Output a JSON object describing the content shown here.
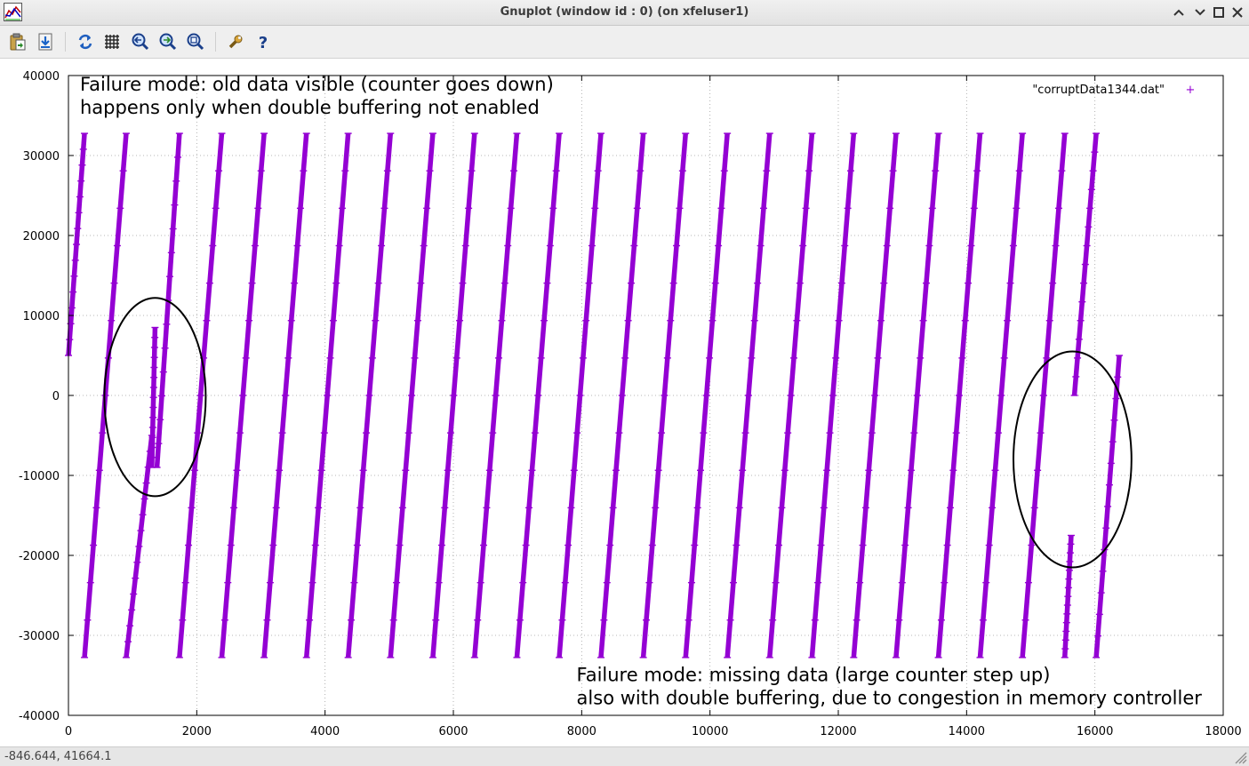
{
  "window": {
    "title": "Gnuplot (window id : 0) (on xfeluser1)"
  },
  "toolbar": {
    "buttons": [
      {
        "name": "copy-clipboard",
        "icon": "clipboard-icon"
      },
      {
        "name": "export",
        "icon": "export-down-icon"
      },
      {
        "name": "replot",
        "icon": "refresh-icon"
      },
      {
        "name": "grid",
        "icon": "grid-icon"
      },
      {
        "name": "previous-zoom",
        "icon": "zoom-prev-icon"
      },
      {
        "name": "next-zoom",
        "icon": "zoom-next-icon"
      },
      {
        "name": "autoscale",
        "icon": "zoom-autoscale-icon"
      },
      {
        "name": "settings",
        "icon": "wrench-icon"
      },
      {
        "name": "help",
        "icon": "help-icon"
      }
    ]
  },
  "status": {
    "coords": "-846.644,  41664.1"
  },
  "colors": {
    "series": "#9400d3",
    "grid": "#a0a0a0",
    "axis": "#000000",
    "annotation": "#000000"
  },
  "chart_data": {
    "type": "line",
    "title": "",
    "xlabel": "",
    "ylabel": "",
    "xlim": [
      0,
      18000
    ],
    "ylim": [
      -40000,
      40000
    ],
    "grid": true,
    "legend_position": "top-right",
    "xticks": [
      0,
      2000,
      4000,
      6000,
      8000,
      10000,
      12000,
      14000,
      16000,
      18000
    ],
    "yticks": [
      -40000,
      -30000,
      -20000,
      -10000,
      0,
      10000,
      20000,
      30000,
      40000
    ],
    "series": [
      {
        "name": "\"corruptData1344.dat\"",
        "marker": "+",
        "segments": [
          [
            [
              0,
              5000
            ],
            [
              250,
              32767
            ]
          ],
          [
            [
              250,
              -32768
            ],
            [
              900,
              32767
            ]
          ],
          [
            [
              900,
              -32768
            ],
            [
              1300,
              -5000
            ]
          ],
          [
            [
              1300,
              -9000
            ],
            [
              1350,
              8500
            ]
          ],
          [
            [
              1380,
              -9000
            ],
            [
              1730,
              32767
            ]
          ],
          [
            [
              1730,
              -32768
            ],
            [
              2390,
              32767
            ]
          ],
          [
            [
              2390,
              -32768
            ],
            [
              3050,
              32767
            ]
          ],
          [
            [
              3050,
              -32768
            ],
            [
              3710,
              32767
            ]
          ],
          [
            [
              3710,
              -32768
            ],
            [
              4360,
              32767
            ]
          ],
          [
            [
              4360,
              -32768
            ],
            [
              5020,
              32767
            ]
          ],
          [
            [
              5020,
              -32768
            ],
            [
              5680,
              32767
            ]
          ],
          [
            [
              5680,
              -32768
            ],
            [
              6330,
              32767
            ]
          ],
          [
            [
              6330,
              -32768
            ],
            [
              6990,
              32767
            ]
          ],
          [
            [
              6990,
              -32768
            ],
            [
              7650,
              32767
            ]
          ],
          [
            [
              7650,
              -32768
            ],
            [
              8300,
              32767
            ]
          ],
          [
            [
              8300,
              -32768
            ],
            [
              8960,
              32767
            ]
          ],
          [
            [
              8960,
              -32768
            ],
            [
              9620,
              32767
            ]
          ],
          [
            [
              9620,
              -32768
            ],
            [
              10270,
              32767
            ]
          ],
          [
            [
              10270,
              -32768
            ],
            [
              10930,
              32767
            ]
          ],
          [
            [
              10930,
              -32768
            ],
            [
              11590,
              32767
            ]
          ],
          [
            [
              11590,
              -32768
            ],
            [
              12240,
              32767
            ]
          ],
          [
            [
              12240,
              -32768
            ],
            [
              12900,
              32767
            ]
          ],
          [
            [
              12900,
              -32768
            ],
            [
              13560,
              32767
            ]
          ],
          [
            [
              13560,
              -32768
            ],
            [
              14210,
              32767
            ]
          ],
          [
            [
              14210,
              -32768
            ],
            [
              14870,
              32767
            ]
          ],
          [
            [
              14870,
              -32768
            ],
            [
              15530,
              32767
            ]
          ],
          [
            [
              15530,
              -32768
            ],
            [
              15630,
              -17500
            ]
          ],
          [
            [
              15680,
              0
            ],
            [
              16020,
              32767
            ]
          ],
          [
            [
              16020,
              -32768
            ],
            [
              16380,
              5000
            ]
          ]
        ]
      }
    ],
    "annotations": [
      {
        "text": "Failure mode: old data visible (counter goes down)",
        "x": 180,
        "y": 38100
      },
      {
        "text": "happens only when double buffering not enabled",
        "x": 180,
        "y": 35200
      },
      {
        "text": "Failure mode: missing data (large counter step up)",
        "x": 7920,
        "y": -35700
      },
      {
        "text": "also with double buffering, due to congestion in memory controller",
        "x": 7920,
        "y": -38600
      }
    ],
    "ellipses": [
      {
        "cx": 1350,
        "cy": -200,
        "rx": 790,
        "ry": 12400
      },
      {
        "cx": 15650,
        "cy": -8000,
        "rx": 920,
        "ry": 13500
      }
    ]
  }
}
